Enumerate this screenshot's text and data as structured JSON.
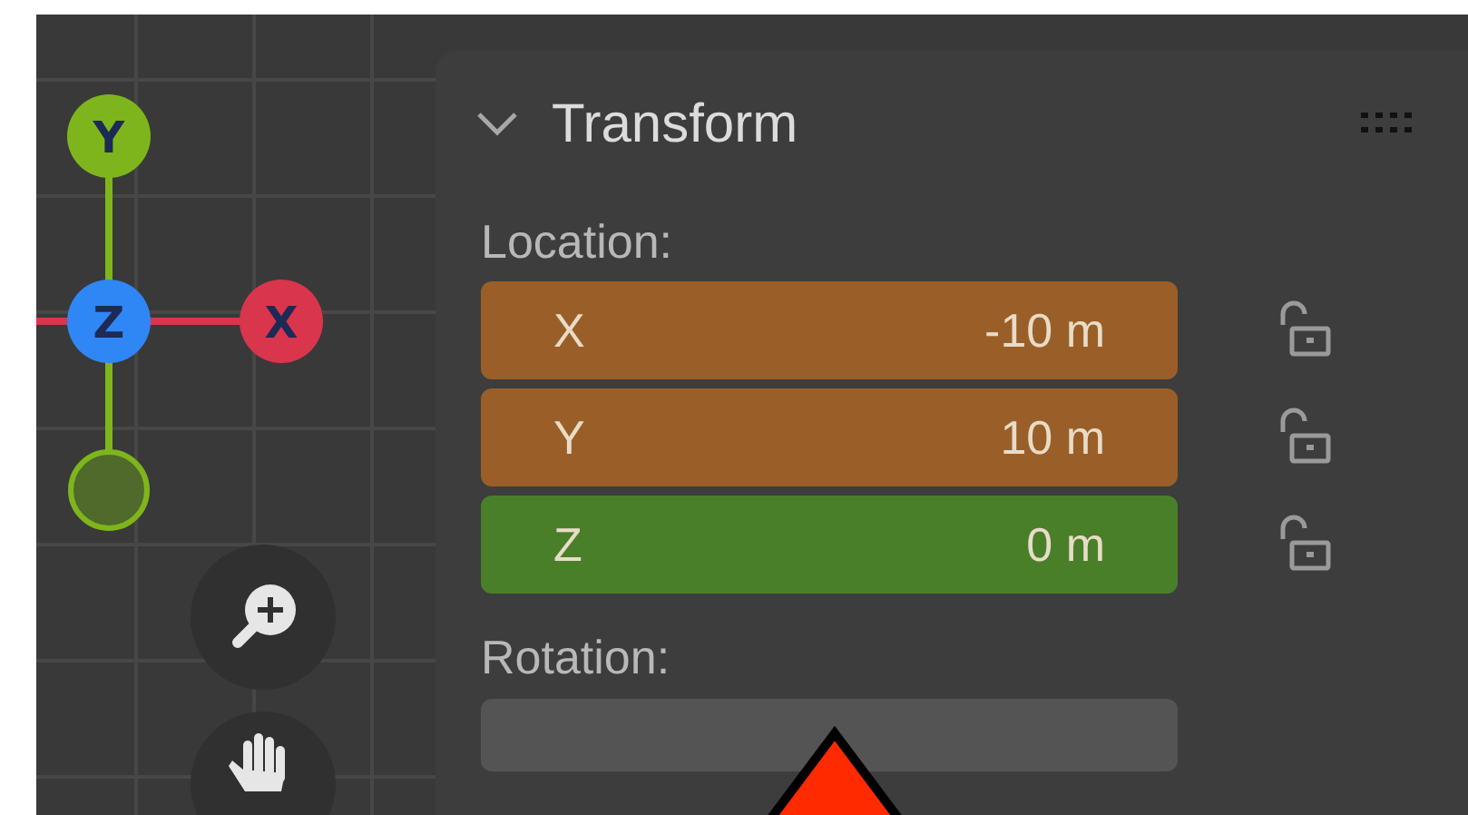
{
  "gizmo": {
    "axes": [
      {
        "label": "Y",
        "color": "#7fb51c"
      },
      {
        "label": "Z",
        "color": "#2f86f5"
      },
      {
        "label": "X",
        "color": "#d9354d"
      }
    ]
  },
  "panel": {
    "title": "Transform",
    "expanded": true,
    "sections": [
      {
        "label": "Location:",
        "fields": [
          {
            "axis": "X",
            "value": "-10 m",
            "color": "#9a5f28",
            "locked": false
          },
          {
            "axis": "Y",
            "value": "10 m",
            "color": "#9a5f28",
            "locked": false
          },
          {
            "axis": "Z",
            "value": "0 m",
            "color": "#4a7f2a",
            "locked": false
          }
        ]
      },
      {
        "label": "Rotation:"
      }
    ]
  }
}
